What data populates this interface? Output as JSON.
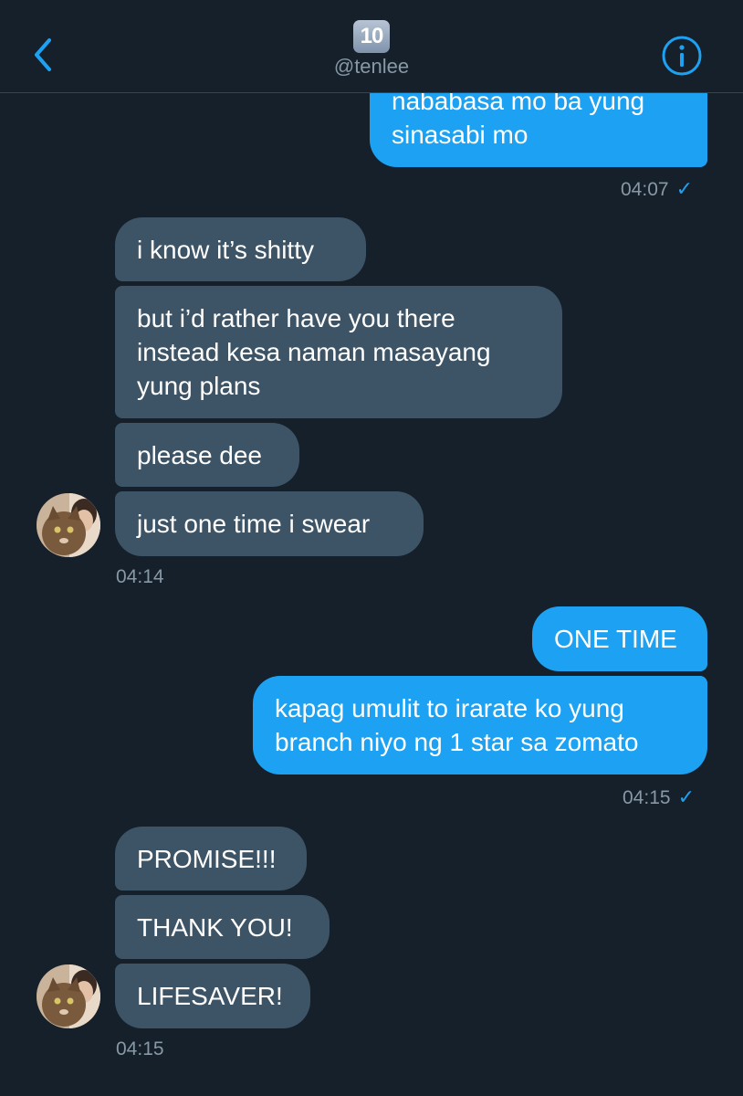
{
  "header": {
    "title_badge": "10",
    "handle": "@tenlee"
  },
  "messages": {
    "m1": "nababasa mo ba yung sinasabi mo",
    "t1": "04:07",
    "m2": "i know it’s shitty",
    "m3": "but i’d rather have you there instead kesa naman masayang yung plans",
    "m4": "please dee",
    "m5": "just one time i swear",
    "t2": "04:14",
    "m6": "ONE TIME",
    "m7": "kapag umulit to irarate ko yung branch niyo ng 1 star sa zomato",
    "t3": "04:15",
    "m8": "PROMISE!!!",
    "m9": "THANK YOU!",
    "m10": "LIFESAVER!",
    "t4": "04:15"
  },
  "read_mark": "✓",
  "colors": {
    "background": "#15202b",
    "sent_bubble": "#1da1f2",
    "received_bubble": "#3d5466",
    "accent": "#1da1f2",
    "muted_text": "#8899a6"
  },
  "icons": [
    "back-chevron-icon",
    "info-icon",
    "avatar"
  ]
}
